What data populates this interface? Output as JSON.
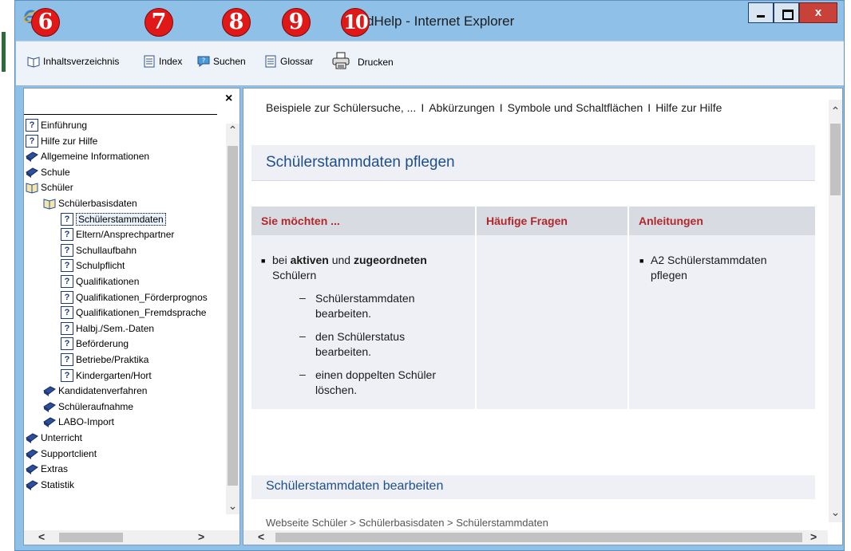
{
  "window": {
    "title": "LusdHelp - Internet Explorer",
    "controls": {
      "min_glyph": "",
      "max_glyph": "",
      "close_glyph": "x"
    }
  },
  "badges": [
    "6",
    "7",
    "8",
    "9",
    "10"
  ],
  "toolbar": {
    "items": [
      {
        "label": "Inhaltsverzeichnis",
        "icon": "book-open-icon"
      },
      {
        "label": "Index",
        "icon": "index-page-icon"
      },
      {
        "label": "Suchen",
        "icon": "search-speech-icon"
      },
      {
        "label": "Glossar",
        "icon": "glossary-page-icon"
      },
      {
        "label": "Drucken",
        "icon": "printer-icon"
      }
    ]
  },
  "left_pane": {
    "close_glyph": "×",
    "tree": [
      {
        "label": "Einführung",
        "icon": "help-page-icon",
        "level": 0
      },
      {
        "label": "Hilfe zur Hilfe",
        "icon": "help-page-icon",
        "level": 0
      },
      {
        "label": "Allgemeine Informationen",
        "icon": "closed-book-icon",
        "level": 0
      },
      {
        "label": "Schule",
        "icon": "closed-book-icon",
        "level": 0
      },
      {
        "label": "Schüler",
        "icon": "open-book-icon",
        "level": 0
      },
      {
        "label": "Schülerbasisdaten",
        "icon": "open-book-icon",
        "level": 1
      },
      {
        "label": "Schülerstammdaten",
        "icon": "help-page-icon",
        "level": 2,
        "selected": true
      },
      {
        "label": "Eltern/Ansprechpartner",
        "icon": "help-page-icon",
        "level": 2
      },
      {
        "label": "Schullaufbahn",
        "icon": "help-page-icon",
        "level": 2
      },
      {
        "label": "Schulpflicht",
        "icon": "help-page-icon",
        "level": 2
      },
      {
        "label": "Qualifikationen",
        "icon": "help-page-icon",
        "level": 2
      },
      {
        "label": "Qualifikationen_Förderprognos",
        "icon": "help-page-icon",
        "level": 2
      },
      {
        "label": "Qualifikationen_Fremdsprache",
        "icon": "help-page-icon",
        "level": 2
      },
      {
        "label": "Halbj./Sem.-Daten",
        "icon": "help-page-icon",
        "level": 2
      },
      {
        "label": "Beförderung",
        "icon": "help-page-icon",
        "level": 2
      },
      {
        "label": "Betriebe/Praktika",
        "icon": "help-page-icon",
        "level": 2
      },
      {
        "label": "Kindergarten/Hort",
        "icon": "help-page-icon",
        "level": 2
      },
      {
        "label": "Kandidatenverfahren",
        "icon": "closed-book-icon",
        "level": 1
      },
      {
        "label": "Schüleraufnahme",
        "icon": "closed-book-icon",
        "level": 1
      },
      {
        "label": "LABO-Import",
        "icon": "closed-book-icon",
        "level": 1
      },
      {
        "label": "Unterricht",
        "icon": "closed-book-icon",
        "level": 0
      },
      {
        "label": "Supportclient",
        "icon": "closed-book-icon",
        "level": 0
      },
      {
        "label": "Extras",
        "icon": "closed-book-icon",
        "level": 0
      },
      {
        "label": "Statistik",
        "icon": "closed-book-icon",
        "level": 0
      }
    ]
  },
  "content": {
    "links": [
      "Beispiele zur Schülersuche, ...",
      "Abkürzungen",
      "Symbole und Schaltflächen",
      "Hilfe zur Hilfe"
    ],
    "link_separator": "I",
    "heading": "Schülerstammdaten pflegen",
    "table": {
      "headers": [
        "Sie möchten ...",
        "Häufige Fragen",
        "Anleitungen"
      ],
      "col1": {
        "intro_pre": "bei ",
        "intro_b1": "aktiven",
        "intro_mid": " und ",
        "intro_b2": "zugeordneten",
        "intro_line2": "Schülern",
        "dashes": [
          [
            "Schülerstammdaten",
            "bearbeiten."
          ],
          [
            "den Schülerstatus",
            "bearbeiten."
          ],
          [
            "einen doppelten Schüler",
            "löschen."
          ]
        ]
      },
      "col3": [
        "A2 Schülerstammdaten",
        "pflegen"
      ]
    },
    "subheading": "Schülerstammdaten bearbeiten",
    "footer_crumb": "Webseite Schüler > Schülerbasisdaten > Schülerstammdaten"
  },
  "colors": {
    "title_bar": "#8fc0e8",
    "badge": "#e01818",
    "heading_blue": "#1f4f8a",
    "header_red": "#b0282c"
  }
}
